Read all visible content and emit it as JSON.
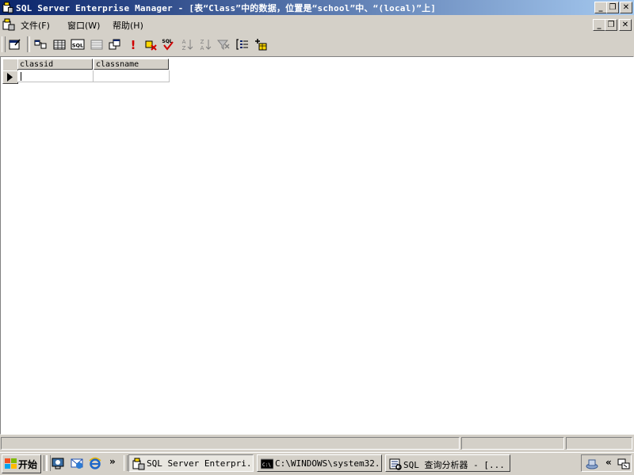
{
  "window": {
    "title": "SQL Server Enterprise Manager - [表“Class”中的数据，位置是“school”中、“(local)”上]",
    "buttons": {
      "minimize": "_",
      "restore": "❐",
      "close": "✕"
    }
  },
  "menubar": {
    "items": [
      {
        "label": "文件(F)"
      },
      {
        "label": "窗口(W)"
      },
      {
        "label": "帮助(H)"
      }
    ],
    "mdi_buttons": {
      "minimize": "_",
      "restore": "❐",
      "close": "✕"
    }
  },
  "toolbar": {
    "buttons": [
      {
        "icon": "properties-icon"
      },
      {
        "icon": "show-diagram-pane-icon"
      },
      {
        "icon": "show-grid-pane-icon"
      },
      {
        "icon": "show-sql-pane-icon",
        "label": "SQL"
      },
      {
        "icon": "show-results-pane-icon"
      },
      {
        "icon": "change-query-type-icon"
      },
      {
        "icon": "run-icon",
        "label": "!"
      },
      {
        "icon": "cancel-query-icon"
      },
      {
        "icon": "verify-sql-icon",
        "label": "SQL"
      },
      {
        "icon": "sort-ascending-icon"
      },
      {
        "icon": "sort-descending-icon"
      },
      {
        "icon": "remove-filter-icon"
      },
      {
        "icon": "group-by-icon"
      },
      {
        "icon": "add-table-icon"
      }
    ]
  },
  "grid": {
    "columns": [
      {
        "label": "classid"
      },
      {
        "label": "classname"
      }
    ],
    "rows": [
      {
        "classid": "",
        "classname": "",
        "is_new": true
      }
    ]
  },
  "statusbar": {
    "panes": [
      "",
      "",
      ""
    ]
  },
  "taskbar": {
    "start_label": "开始",
    "quicklaunch": [
      {
        "icon": "show-desktop-icon"
      },
      {
        "icon": "outlook-express-icon"
      },
      {
        "icon": "internet-explorer-icon"
      }
    ],
    "chevron": "»",
    "tasks": [
      {
        "label": "SQL Server Enterpri...",
        "icon": "enterprise-manager-icon",
        "active": true
      },
      {
        "label": "C:\\WINDOWS\\system32...",
        "icon": "command-prompt-icon",
        "active": false
      },
      {
        "label": "SQL 查询分析器 - [...",
        "icon": "query-analyzer-icon",
        "active": false
      }
    ],
    "tray": {
      "chevron": "«"
    }
  },
  "colors": {
    "title_gradient_start": "#0a246a",
    "title_gradient_end": "#a6caf0",
    "face": "#d4d0c8"
  }
}
